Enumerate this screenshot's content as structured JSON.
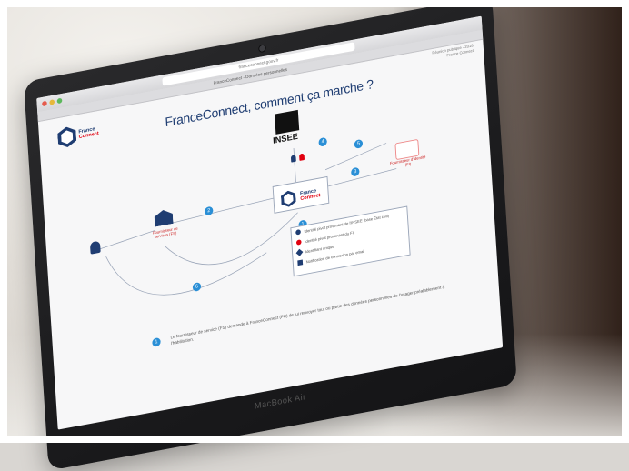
{
  "photo": {
    "laptop_brand": "MacBook Air"
  },
  "browser": {
    "url": "franceconnect.gouv.fr",
    "tab_title": "FranceConnect - Données personnelles",
    "meta_line_1": "Réunion publique - 2018",
    "meta_line_2": "France Connect"
  },
  "slide": {
    "title": "FranceConnect, comment ça marche ?",
    "logo_line_1": "France",
    "logo_line_2": "Connect",
    "center_logo_line_1": "France",
    "center_logo_line_2": "Connect",
    "insee_label": "INSEE",
    "fs_label": "Fournisseur de services (FS)",
    "fd_label": "Fournisseur d'identité (FI)",
    "badges": [
      "1",
      "2",
      "3",
      "4",
      "5",
      "6"
    ],
    "legend": [
      "Identité pivot provenant de l'INSEE (base État civil)",
      "Identité pivot provenant du FI",
      "Identifiant unique",
      "Notification de connexion par email"
    ],
    "caption": "Le fournisseur de service (FS) demande à FranceConnect (FC) de lui renvoyer tout ou partie des données personnelles de l'usager préalablement à l'habilitation."
  },
  "colors": {
    "navy": "#1f3d72",
    "red": "#e1000f",
    "badge_blue": "#2a8fd6"
  }
}
